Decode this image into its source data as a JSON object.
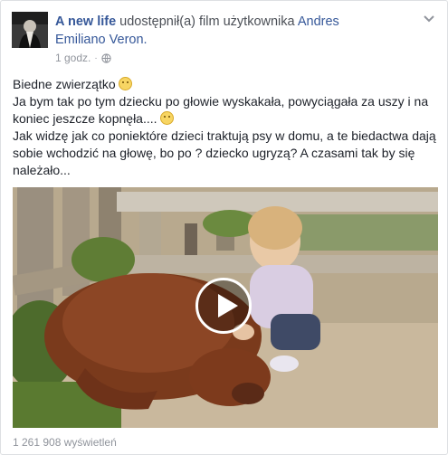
{
  "post": {
    "author": "A new life",
    "action_text": "udostępnił(a) film użytkownika",
    "shared_user": "Andres Emiliano Veron.",
    "time": "1 godz.",
    "separator": "·",
    "avatar_icon": "profile-avatar",
    "privacy_icon": "globe-icon",
    "menu_icon": "chevron-down-icon",
    "text_lines": [
      "Biedne zwierzątko",
      "Ja bym tak po tym dziecku po głowie wyskakała, powyciągała za uszy i na koniec jeszcze kopnęła....",
      "Jak widzę jak co poniektóre dzieci traktują psy w domu, a te biedactwa dają sobie wchodzić na głowę, bo po ? dziecko ugryzą? A czasami tak by się należało..."
    ]
  },
  "video": {
    "play_icon": "play-icon",
    "views": "1 261 908 wyświetleń"
  },
  "colors": {
    "link": "#365899",
    "meta": "#90949c",
    "text": "#1d2129"
  }
}
